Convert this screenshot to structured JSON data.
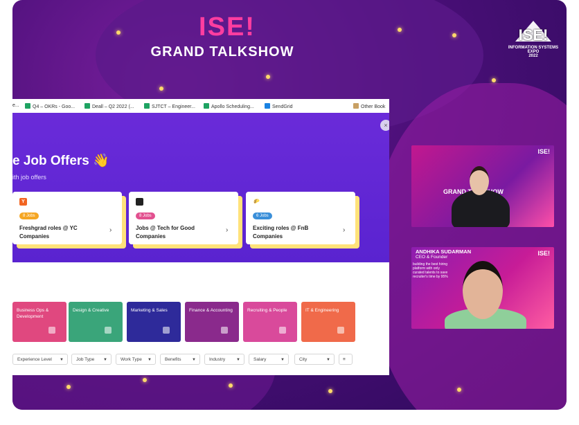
{
  "event": {
    "logo": "ISE!",
    "title": "GRAND TALKSHOW",
    "corner_logo": "ISE!",
    "corner_sub1": "INFORMATION SYSTEMS EXPO",
    "corner_sub2": "2022"
  },
  "bookmarks": [
    {
      "label": "e...",
      "color": "#999999"
    },
    {
      "label": "Q4 – OKRs - Goo...",
      "color": "#1ea362"
    },
    {
      "label": "Deall – Q2 2022 (...",
      "color": "#1ea362"
    },
    {
      "label": "SJTCT – Engineer...",
      "color": "#1ea362"
    },
    {
      "label": "Apollo Scheduling...",
      "color": "#1ea362"
    },
    {
      "label": "SendGrid",
      "color": "#1a82e2"
    },
    {
      "label": "Other Book",
      "color": "#c8a064"
    }
  ],
  "hero": {
    "title": "e Job Offers 👋",
    "subtitle": "ith job offers",
    "close_icon": "×"
  },
  "cards": [
    {
      "icon": "Y",
      "icon_color": "#f26522",
      "badge": "8 Jobs",
      "badge_color": "#f5a623",
      "title": "Freshgrad roles @ YC Companies"
    },
    {
      "icon": "",
      "icon_color": "#222222",
      "badge": "8 Jobs",
      "badge_color": "#e2508f",
      "title": "Jobs @ Tech for Good Companies"
    },
    {
      "icon": "🌮",
      "icon_color": "#f3c26a",
      "badge": "6 Jobs",
      "badge_color": "#3a8fd9",
      "title": "Exciting roles @ FnB Companies"
    }
  ],
  "categories": [
    {
      "label": "Business Ops & Development",
      "color": "#e0487f"
    },
    {
      "label": "Design & Creative",
      "color": "#3aa57a"
    },
    {
      "label": "Marketing & Sales",
      "color": "#2e2a9a"
    },
    {
      "label": "Finance & Accounting",
      "color": "#8a2a8c"
    },
    {
      "label": "Recruiting & People",
      "color": "#d94a9b"
    },
    {
      "label": "IT & Engineering",
      "color": "#f06a4a"
    }
  ],
  "filters": [
    "Experience Level",
    "Job Type",
    "Work Type",
    "Benefits",
    "Industry",
    "Salary",
    "City"
  ],
  "tiles": {
    "tile1_title": "GRAND TALKSHOW",
    "tile1_logo": "ISE!",
    "tile2_name": "ANDHIKA SUDARMAN",
    "tile2_role": "CEO & Founder",
    "tile2_blurb": "building the best hiring platform with only curated talents to save recruiter's time by 95%",
    "tile2_logo": "ISE!"
  }
}
